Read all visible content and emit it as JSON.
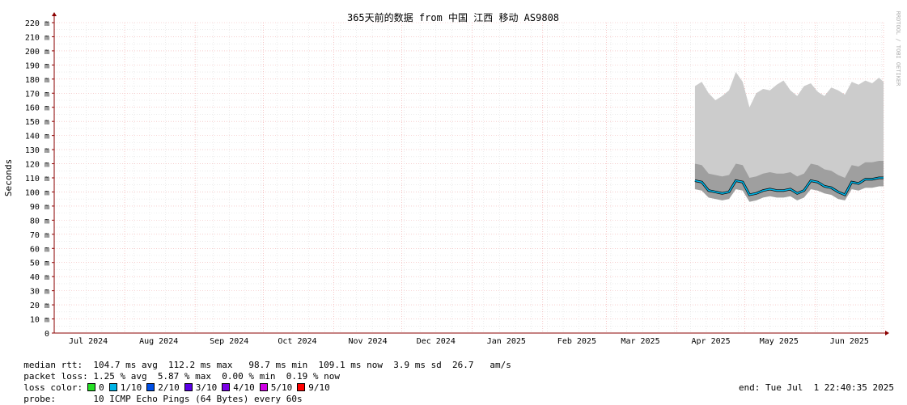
{
  "chart_data": {
    "type": "area",
    "title": "365天前的数据 from 中国 江西 移动 AS9808",
    "ylabel": "Seconds",
    "watermark": "RRDTOOL / TOBI OETIKER",
    "ylim": [
      0,
      0.22
    ],
    "y_ticks": [
      "0",
      "10 m",
      "20 m",
      "30 m",
      "40 m",
      "50 m",
      "60 m",
      "70 m",
      "80 m",
      "90 m",
      "100 m",
      "110 m",
      "120 m",
      "130 m",
      "140 m",
      "150 m",
      "160 m",
      "170 m",
      "180 m",
      "190 m",
      "200 m",
      "210 m",
      "220 m"
    ],
    "x_ticks": [
      "Jul 2024",
      "Aug 2024",
      "Sep 2024",
      "Oct 2024",
      "Nov 2024",
      "Dec 2024",
      "Jan 2025",
      "Feb 2025",
      "Mar 2025",
      "Apr 2025",
      "May 2025",
      "Jun 2025"
    ],
    "x_range": [
      "2024-07-01",
      "2025-07-01"
    ],
    "data_start": "2025-04-09",
    "series": [
      {
        "name": "median rtt",
        "x": [
          "2025-04-09",
          "2025-04-12",
          "2025-04-15",
          "2025-04-18",
          "2025-04-21",
          "2025-04-24",
          "2025-04-27",
          "2025-04-30",
          "2025-05-03",
          "2025-05-06",
          "2025-05-09",
          "2025-05-12",
          "2025-05-15",
          "2025-05-18",
          "2025-05-21",
          "2025-05-24",
          "2025-05-27",
          "2025-05-30",
          "2025-06-02",
          "2025-06-05",
          "2025-06-08",
          "2025-06-11",
          "2025-06-14",
          "2025-06-17",
          "2025-06-20",
          "2025-06-23",
          "2025-06-26",
          "2025-06-29",
          "2025-07-01"
        ],
        "y": [
          0.108,
          0.107,
          0.101,
          0.1,
          0.099,
          0.1,
          0.108,
          0.107,
          0.098,
          0.099,
          0.101,
          0.102,
          0.101,
          0.101,
          0.102,
          0.099,
          0.101,
          0.108,
          0.107,
          0.104,
          0.103,
          0.1,
          0.098,
          0.107,
          0.106,
          0.109,
          0.109,
          0.11,
          0.11
        ]
      }
    ],
    "smoke_max": [
      0.175,
      0.178,
      0.17,
      0.165,
      0.168,
      0.172,
      0.185,
      0.178,
      0.16,
      0.17,
      0.173,
      0.172,
      0.176,
      0.179,
      0.172,
      0.168,
      0.175,
      0.177,
      0.171,
      0.168,
      0.174,
      0.172,
      0.169,
      0.178,
      0.176,
      0.179,
      0.177,
      0.181,
      0.178
    ],
    "smoke_min": [
      0.102,
      0.101,
      0.096,
      0.095,
      0.094,
      0.095,
      0.102,
      0.101,
      0.093,
      0.094,
      0.096,
      0.097,
      0.096,
      0.096,
      0.097,
      0.094,
      0.096,
      0.102,
      0.101,
      0.099,
      0.098,
      0.095,
      0.094,
      0.102,
      0.101,
      0.103,
      0.103,
      0.104,
      0.104
    ],
    "colors": {
      "grid_minor": "#e0e0e0",
      "grid_major": "#f2b0b0",
      "smoke": "#cccccc",
      "smoke_dark": "#8c8c8c",
      "median": "#00b4e6",
      "axis": "#8b0000"
    }
  },
  "legend": {
    "median_rtt": "median rtt:  104.7 ms avg  112.2 ms max   98.7 ms min  109.1 ms now  3.9 ms sd  26.7   am/s",
    "packet_loss": "packet loss: 1.25 % avg  5.87 % max  0.00 % min  0.19 % now",
    "loss_color_label": "loss color:",
    "loss_colors": [
      {
        "label": "0",
        "color": "#26e026"
      },
      {
        "label": "1/10",
        "color": "#00b4e6"
      },
      {
        "label": "2/10",
        "color": "#0050e6"
      },
      {
        "label": "3/10",
        "color": "#5a00e6"
      },
      {
        "label": "4/10",
        "color": "#7a00e6"
      },
      {
        "label": "5/10",
        "color": "#d000e6"
      },
      {
        "label": "9/10",
        "color": "#ff0000"
      }
    ],
    "probe": "probe:       10 ICMP Echo Pings (64 Bytes) every 60s",
    "end": "end: Tue Jul  1 22:40:35 2025"
  }
}
